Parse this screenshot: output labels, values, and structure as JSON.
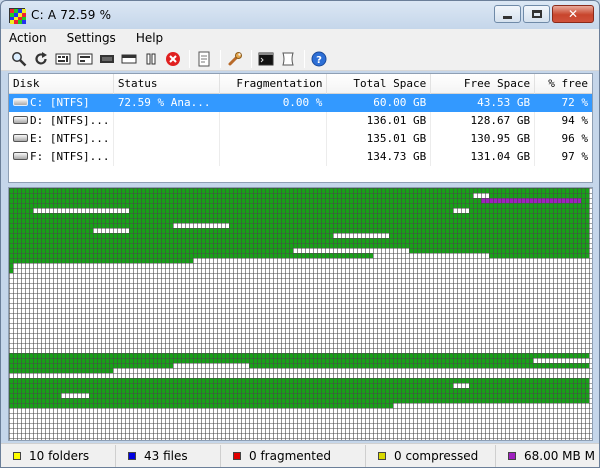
{
  "window": {
    "title": "C:  A  72.59 %"
  },
  "menu": {
    "items": [
      "Action",
      "Settings",
      "Help"
    ]
  },
  "toolbar": {
    "buttons": [
      "analyze-icon",
      "refresh-icon",
      "defrag-icon",
      "quick-optimize-icon",
      "full-optimize-icon",
      "mft-optimize-icon",
      "pause-icon",
      "stop-icon",
      "report-icon",
      "settings-wrench-icon",
      "console-icon",
      "scripts-icon",
      "help-icon"
    ]
  },
  "disks": {
    "columns": [
      "Disk",
      "Status",
      "Fragmentation",
      "Total Space",
      "Free Space",
      "% free"
    ],
    "rows": [
      {
        "disk": "C: [NTFS]",
        "status": "72.59 % Ana...",
        "fragmentation": "0.00 %",
        "total": "60.00 GB",
        "free": "43.53 GB",
        "pct_free": "72 %",
        "selected": true
      },
      {
        "disk": "D: [NTFS]...",
        "status": "",
        "fragmentation": "",
        "total": "136.01 GB",
        "free": "128.67 GB",
        "pct_free": "94 %",
        "selected": false
      },
      {
        "disk": "E: [NTFS]...",
        "status": "",
        "fragmentation": "",
        "total": "135.01 GB",
        "free": "130.95 GB",
        "pct_free": "96 %",
        "selected": false
      },
      {
        "disk": "F: [NTFS]...",
        "status": "",
        "fragmentation": "",
        "total": "134.73 GB",
        "free": "131.04 GB",
        "pct_free": "97 %",
        "selected": false
      }
    ]
  },
  "status_bar": {
    "folders": "10 folders",
    "files": "43 files",
    "fragmented": "0 fragmented",
    "compressed": "0 compressed",
    "mft": "68.00 MB M"
  },
  "colors": {
    "used": "#18a018",
    "mft": "#a020c0",
    "free": "#ffffff",
    "grid_line": "#4a4a4a",
    "legend_folders": "#ffff00",
    "legend_files": "#0000e0",
    "legend_fragmented": "#e00000",
    "legend_compressed": "#d8d800",
    "legend_mft": "#a020c0",
    "selection": "#3399ff"
  }
}
